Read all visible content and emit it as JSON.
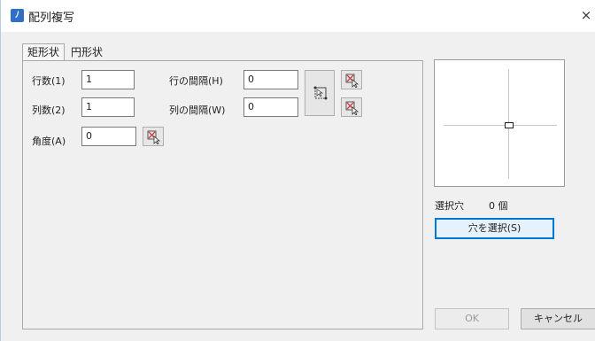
{
  "window": {
    "title": "配列複写",
    "app_icon_glyph": "ﾉ",
    "close_glyph": "×"
  },
  "tabs": [
    {
      "label": "矩形状",
      "active": true
    },
    {
      "label": "円形状",
      "active": false
    }
  ],
  "rectangular": {
    "rows_label": "行数(1)",
    "rows_value": "1",
    "cols_label": "列数(2)",
    "cols_value": "1",
    "angle_label": "角度(A)",
    "angle_value": "0",
    "row_spacing_label": "行の間隔(H)",
    "row_spacing_value": "0",
    "col_spacing_label": "列の間隔(W)",
    "col_spacing_value": "0"
  },
  "selection": {
    "label": "選択穴",
    "count": "0 個",
    "select_button": "穴を選択(S)"
  },
  "footer": {
    "ok": "OK",
    "cancel": "キャンセル"
  },
  "colors": {
    "accent": "#0078d7",
    "app_icon": "#2f6fc5",
    "pick_icon_red": "#d23b3b"
  },
  "icons": {
    "pick_point": "pick-point-icon",
    "pick_both": "pick-both-icon"
  }
}
